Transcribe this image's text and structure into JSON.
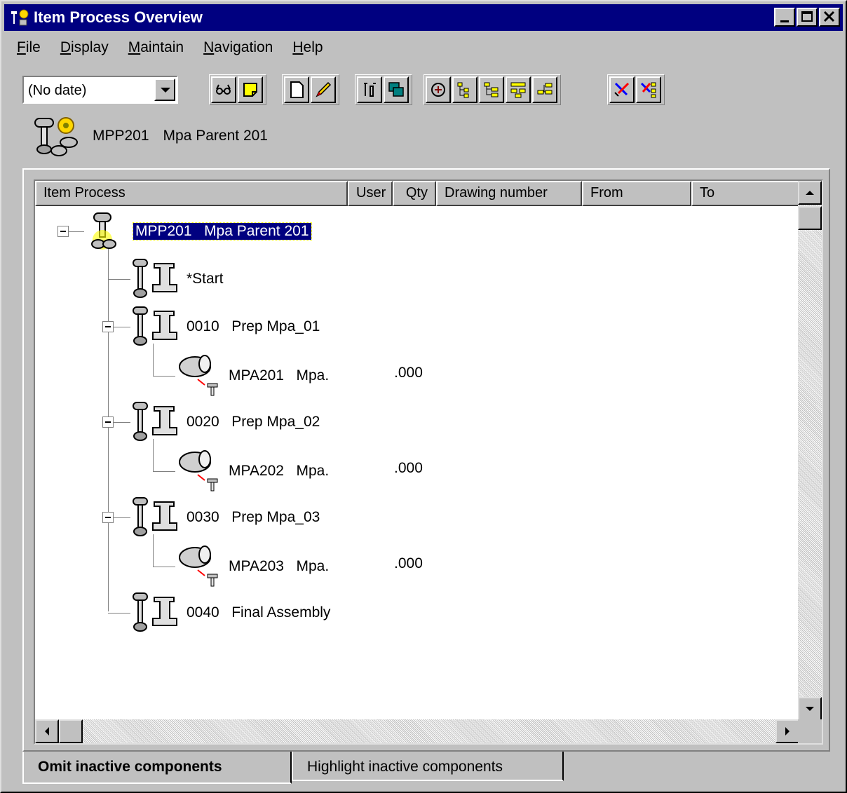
{
  "window": {
    "title": "Item Process Overview"
  },
  "menu": [
    {
      "label": "File",
      "mnemonic": "F",
      "rest": "ile"
    },
    {
      "label": "Display",
      "mnemonic": "D",
      "rest": "isplay"
    },
    {
      "label": "Maintain",
      "mnemonic": "M",
      "rest": "aintain"
    },
    {
      "label": "Navigation",
      "mnemonic": "N",
      "rest": "avigation"
    },
    {
      "label": "Help",
      "mnemonic": "H",
      "rest": "elp"
    }
  ],
  "toolbar": {
    "date_select": "(No date)"
  },
  "context": {
    "item_code": "MPP201",
    "item_name": "Mpa Parent 201"
  },
  "columns": [
    "Item Process",
    "User",
    "Qty",
    "Drawing number",
    "From",
    "To"
  ],
  "tree": {
    "root": {
      "code": "MPP201",
      "name": "Mpa Parent 201"
    },
    "operations": [
      {
        "label": "*Start"
      },
      {
        "label": "0010   Prep Mpa_01",
        "component": {
          "label": "MPA201   Mpa.",
          "qty": ".000"
        }
      },
      {
        "label": "0020   Prep Mpa_02",
        "component": {
          "label": "MPA202   Mpa.",
          "qty": ".000"
        }
      },
      {
        "label": "0030   Prep Mpa_03",
        "component": {
          "label": "MPA203   Mpa.",
          "qty": ".000"
        }
      },
      {
        "label": "0040   Final Assembly"
      }
    ]
  },
  "tabs": [
    {
      "label": "Omit inactive components",
      "active": true
    },
    {
      "label": "Highlight inactive components",
      "active": false
    }
  ]
}
